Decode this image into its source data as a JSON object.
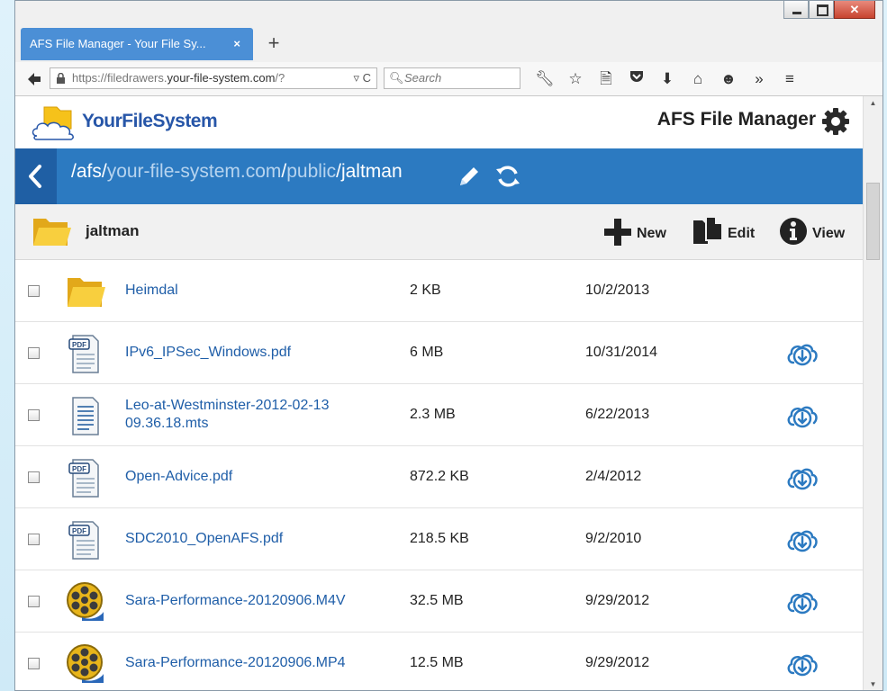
{
  "browser": {
    "tab_title": "AFS File Manager - Your File Sy...",
    "tab_close": "×",
    "new_tab": "+",
    "url_prefix": "https://filedrawers.",
    "url_domain": "your-file-system.com",
    "url_suffix": "/?",
    "url_reload": "▿ C",
    "search_placeholder": "Search"
  },
  "header": {
    "logo_text": "YourFileSystem",
    "app_title": "AFS File Manager"
  },
  "path": {
    "seg1": "/afs/",
    "seg2": "your-file-system.com",
    "seg3": "/",
    "seg4": "public",
    "seg5": "/jaltman"
  },
  "folder": {
    "name": "jaltman",
    "actions": {
      "new": "New",
      "edit": "Edit",
      "view": "View"
    }
  },
  "files": [
    {
      "name": "Heimdal",
      "size": "2 KB",
      "date": "10/2/2013",
      "type": "folder",
      "download": false
    },
    {
      "name": "IPv6_IPSec_Windows.pdf",
      "size": "6 MB",
      "date": "10/31/2014",
      "type": "pdf",
      "download": true
    },
    {
      "name": "Leo-at-Westminster-2012-02-13 09.36.18.mts",
      "size": "2.3 MB",
      "date": "6/22/2013",
      "type": "doc",
      "download": true
    },
    {
      "name": "Open-Advice.pdf",
      "size": "872.2 KB",
      "date": "2/4/2012",
      "type": "pdf",
      "download": true
    },
    {
      "name": "SDC2010_OpenAFS.pdf",
      "size": "218.5 KB",
      "date": "9/2/2010",
      "type": "pdf",
      "download": true
    },
    {
      "name": "Sara-Performance-20120906.M4V",
      "size": "32.5 MB",
      "date": "9/29/2012",
      "type": "video",
      "download": true
    },
    {
      "name": "Sara-Performance-20120906.MP4",
      "size": "12.5 MB",
      "date": "9/29/2012",
      "type": "video",
      "download": true
    }
  ],
  "colors": {
    "path_bar": "#2c7ac1",
    "link": "#1f5ea8",
    "tab": "#4b8fd6"
  }
}
